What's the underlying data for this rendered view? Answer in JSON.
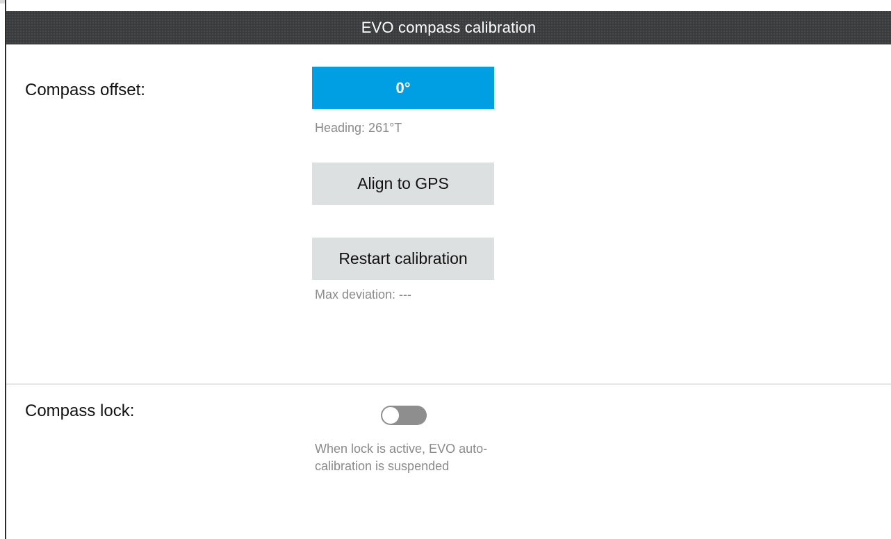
{
  "window": {
    "title": "EVO compass calibration"
  },
  "compass_offset": {
    "label": "Compass offset:",
    "value": "0°",
    "heading_text": "Heading: 261°T",
    "align_button_label": "Align to GPS",
    "restart_button_label": "Restart calibration",
    "max_deviation_text": "Max deviation: ---"
  },
  "compass_lock": {
    "label": "Compass lock:",
    "toggle_state": "off",
    "note": "When lock is active, EVO auto-calibration is suspended"
  },
  "colors": {
    "accent": "#009fe3",
    "title_bar": "#3a3b3d",
    "button_grey": "#dde0e0",
    "toggle_off": "#8e8e8e"
  },
  "icons": {
    "toggle": "toggle-switch-icon"
  }
}
